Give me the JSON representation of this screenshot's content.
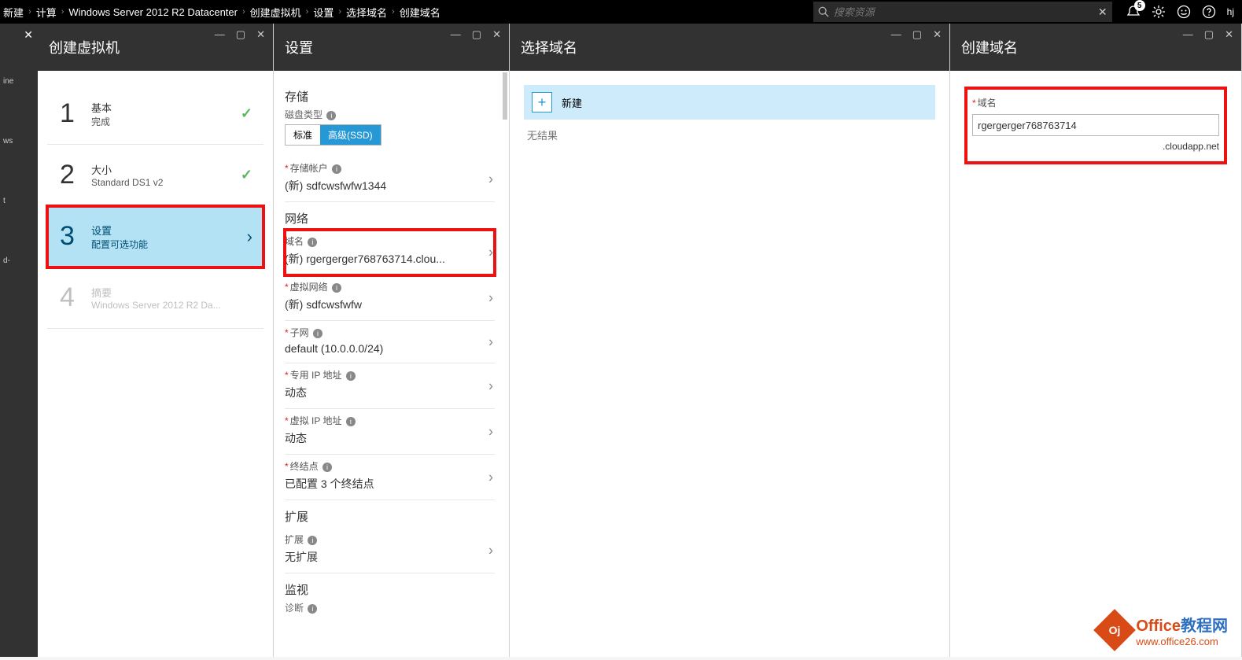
{
  "breadcrumb": [
    "新建",
    "计算",
    "Windows Server 2012 R2 Datacenter",
    "创建虚拟机",
    "设置",
    "选择域名",
    "创建域名"
  ],
  "search": {
    "placeholder": "搜索资源"
  },
  "notifications": {
    "count": "5"
  },
  "user": {
    "label": "hj"
  },
  "blade1": {
    "title": "创建虚拟机",
    "steps": [
      {
        "num": "1",
        "title": "基本",
        "sub": "完成",
        "state": "done"
      },
      {
        "num": "2",
        "title": "大小",
        "sub": "Standard DS1 v2",
        "state": "done"
      },
      {
        "num": "3",
        "title": "设置",
        "sub": "配置可选功能",
        "state": "active"
      },
      {
        "num": "4",
        "title": "摘要",
        "sub": "Windows Server 2012 R2 Da...",
        "state": "disabled"
      }
    ]
  },
  "blade2": {
    "title": "设置",
    "storage": {
      "section": "存储",
      "diskTypeLabel": "磁盘类型",
      "toggle": {
        "opt1": "标准",
        "opt2": "高级(SSD)"
      },
      "accountLabel": "存储帐户",
      "accountValue": "(新) sdfcwsfwfw1344"
    },
    "network": {
      "section": "网络",
      "domainLabel": "域名",
      "domainValue": "(新) rgergerger768763714.clou...",
      "vnetLabel": "虚拟网络",
      "vnetValue": "(新) sdfcwsfwfw",
      "subnetLabel": "子网",
      "subnetValue": "default (10.0.0.0/24)",
      "privIpLabel": "专用 IP 地址",
      "privIpValue": "动态",
      "vipLabel": "虚拟 IP 地址",
      "vipValue": "动态",
      "endpointLabel": "终结点",
      "endpointValue": "已配置 3 个终结点"
    },
    "extensions": {
      "section": "扩展",
      "label": "扩展",
      "value": "无扩展"
    },
    "monitor": {
      "section": "监视",
      "diagLabel": "诊断"
    }
  },
  "blade3": {
    "title": "选择域名",
    "newLabel": "新建",
    "noResult": "无结果"
  },
  "blade4": {
    "title": "创建域名",
    "fieldLabel": "域名",
    "value": "rgergerger768763714",
    "suffix": ".cloudapp.net"
  },
  "watermark": {
    "brand1": "Office",
    "brand2": "教程网",
    "url": "www.office26.com"
  },
  "leftStrip": {
    "items": [
      "ine",
      "ws",
      "t",
      "d-"
    ]
  }
}
